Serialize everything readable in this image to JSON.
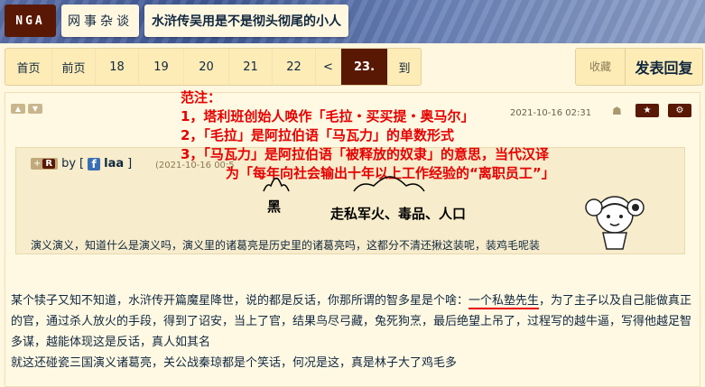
{
  "header": {
    "logo": "NGA",
    "section": "网事杂谈",
    "thread_title": "水浒传吴用是不是彻头彻尾的小人"
  },
  "pagination": {
    "items": [
      {
        "label": "首页"
      },
      {
        "label": "前页"
      },
      {
        "label": "18"
      },
      {
        "label": "19"
      },
      {
        "label": "20"
      },
      {
        "label": "21"
      },
      {
        "label": "22"
      },
      {
        "label": "<"
      },
      {
        "label": "23."
      },
      {
        "label": "到"
      }
    ],
    "current": "23."
  },
  "actions": {
    "favorite": "收藏",
    "reply": "发表回复"
  },
  "post": {
    "timestamp": "2021-10-16 02:31",
    "icons": [
      "thumbs-up-icon",
      "thumbs-down-icon",
      "android-icon",
      "star-icon",
      "gear-icon"
    ],
    "quote": {
      "plus": "+",
      "rank": "R",
      "by": "by",
      "user_icon": "f",
      "user_name": "laa",
      "bracket_open": "[",
      "bracket_close": "]",
      "time": "(2021-10-16 00:5",
      "text": "演义演义，知道什么是演义吗，演义里的诸葛亮是历史里的诸葛亮吗，这都分不清还揪这装呢，装鸡毛呢装"
    },
    "annotation": {
      "title": "范注：",
      "lines": [
        "1，塔利班创始人唤作「毛拉・买买提・奥马尔」",
        "2，「毛拉」是阿拉伯语「马瓦力」的单数形式",
        "3，「马瓦力」是阿拉伯语「被释放的奴隶」的意思，当代汉译",
        "为「每年向社会输出十年以上工作经验的“离职员工”」"
      ],
      "note_black": "黑",
      "note_list": "走私军火、毒品、人口"
    },
    "body": {
      "p1_a": "某个犊子又知不知道，水浒传开篇魔星降世，说的都是反话，你那所谓的智多星是个啥：",
      "p1_underlined": "一个私塾先生",
      "p1_b": "，为了主子以及自己能做真正的官，通过杀人放火的手段，得到了诏安，当上了官，结果鸟尽弓藏，兔死狗烹，最后绝望上吊了，过程写的越牛逼，写得他越足智多谋，越能体现这是反话，真人如其名",
      "p2": "就这还碰瓷三国演义诸葛亮，关公战秦琼都是个笑话，何况是这，真是林子大了鸡毛多"
    }
  },
  "colors": {
    "accent": "#591804",
    "text": "#10273f",
    "annotation": "#e60000",
    "page_bg": "#fff7e0"
  }
}
